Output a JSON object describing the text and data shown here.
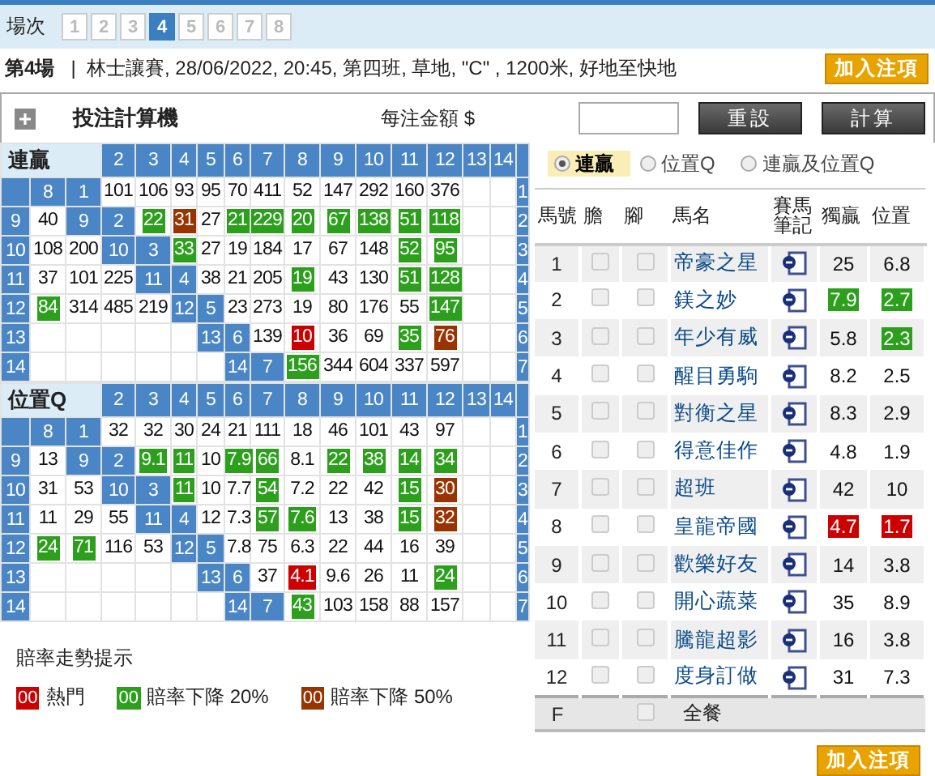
{
  "race_selector": {
    "label": "場次",
    "races": [
      {
        "label": "1",
        "selected": false
      },
      {
        "label": "2",
        "selected": false
      },
      {
        "label": "3",
        "selected": false
      },
      {
        "label": "4",
        "selected": true
      },
      {
        "label": "5",
        "selected": false
      },
      {
        "label": "6",
        "selected": false
      },
      {
        "label": "7",
        "selected": false
      },
      {
        "label": "8",
        "selected": false
      }
    ]
  },
  "race_info": {
    "race": "第4場",
    "separator": "|",
    "details": "林士讓賽, 28/06/2022, 20:45, 第四班, 草地, \"C\" , 1200米, 好地至快地",
    "add_button": "加入注項"
  },
  "calculator": {
    "title": "投注計算機",
    "amount_label": "每注金額 $",
    "reset_button": "重設",
    "calculate_button": "計算"
  },
  "grids": [
    {
      "title": "連贏",
      "headers": [
        "2",
        "3",
        "4",
        "5",
        "6",
        "7",
        "8",
        "9",
        "10",
        "11",
        "12",
        "13",
        "14"
      ],
      "rows": [
        [
          {
            "kind": "head"
          },
          {
            "kind": "head",
            "text": "8"
          },
          {
            "kind": "head",
            "text": "1"
          },
          {
            "kind": "odds",
            "text": "101"
          },
          {
            "kind": "odds",
            "text": "106"
          },
          {
            "kind": "odds",
            "text": "93"
          },
          {
            "kind": "odds",
            "text": "95"
          },
          {
            "kind": "odds",
            "text": "70"
          },
          {
            "kind": "odds",
            "text": "411"
          },
          {
            "kind": "odds",
            "text": "52"
          },
          {
            "kind": "odds",
            "text": "147"
          },
          {
            "kind": "odds",
            "text": "292"
          },
          {
            "kind": "odds",
            "text": "160"
          },
          {
            "kind": "odds",
            "text": "376"
          },
          {
            "kind": "blank"
          },
          {
            "kind": "blank"
          },
          {
            "kind": "head",
            "text": "1"
          }
        ],
        [
          {
            "kind": "head",
            "text": "9"
          },
          {
            "kind": "odds",
            "text": "40"
          },
          {
            "kind": "head",
            "text": "9"
          },
          {
            "kind": "head",
            "text": "2"
          },
          {
            "kind": "odds",
            "text": "22",
            "color": "#2ca01c"
          },
          {
            "kind": "odds",
            "text": "31",
            "color": "#993300"
          },
          {
            "kind": "odds",
            "text": "27"
          },
          {
            "kind": "odds",
            "text": "21",
            "color": "#2ca01c"
          },
          {
            "kind": "odds",
            "text": "229",
            "color": "#2ca01c"
          },
          {
            "kind": "odds",
            "text": "20",
            "color": "#2ca01c"
          },
          {
            "kind": "odds",
            "text": "67",
            "color": "#2ca01c"
          },
          {
            "kind": "odds",
            "text": "138",
            "color": "#2ca01c"
          },
          {
            "kind": "odds",
            "text": "51",
            "color": "#2ca01c"
          },
          {
            "kind": "odds",
            "text": "118",
            "color": "#2ca01c"
          },
          {
            "kind": "blank"
          },
          {
            "kind": "blank"
          },
          {
            "kind": "head",
            "text": "2"
          }
        ],
        [
          {
            "kind": "head",
            "text": "10"
          },
          {
            "kind": "odds",
            "text": "108"
          },
          {
            "kind": "odds",
            "text": "200"
          },
          {
            "kind": "head",
            "text": "10"
          },
          {
            "kind": "head",
            "text": "3"
          },
          {
            "kind": "odds",
            "text": "33",
            "color": "#2ca01c"
          },
          {
            "kind": "odds",
            "text": "27"
          },
          {
            "kind": "odds",
            "text": "19"
          },
          {
            "kind": "odds",
            "text": "184"
          },
          {
            "kind": "odds",
            "text": "17"
          },
          {
            "kind": "odds",
            "text": "67"
          },
          {
            "kind": "odds",
            "text": "148"
          },
          {
            "kind": "odds",
            "text": "52",
            "color": "#2ca01c"
          },
          {
            "kind": "odds",
            "text": "95",
            "color": "#2ca01c"
          },
          {
            "kind": "blank"
          },
          {
            "kind": "blank"
          },
          {
            "kind": "head",
            "text": "3"
          }
        ],
        [
          {
            "kind": "head",
            "text": "11"
          },
          {
            "kind": "odds",
            "text": "37"
          },
          {
            "kind": "odds",
            "text": "101"
          },
          {
            "kind": "odds",
            "text": "225"
          },
          {
            "kind": "head",
            "text": "11"
          },
          {
            "kind": "head",
            "text": "4"
          },
          {
            "kind": "odds",
            "text": "38"
          },
          {
            "kind": "odds",
            "text": "21"
          },
          {
            "kind": "odds",
            "text": "205"
          },
          {
            "kind": "odds",
            "text": "19",
            "color": "#2ca01c"
          },
          {
            "kind": "odds",
            "text": "43"
          },
          {
            "kind": "odds",
            "text": "130"
          },
          {
            "kind": "odds",
            "text": "51",
            "color": "#2ca01c"
          },
          {
            "kind": "odds",
            "text": "128",
            "color": "#2ca01c"
          },
          {
            "kind": "blank"
          },
          {
            "kind": "blank"
          },
          {
            "kind": "head",
            "text": "4"
          }
        ],
        [
          {
            "kind": "head",
            "text": "12"
          },
          {
            "kind": "odds",
            "text": "84",
            "color": "#2ca01c"
          },
          {
            "kind": "odds",
            "text": "314"
          },
          {
            "kind": "odds",
            "text": "485"
          },
          {
            "kind": "odds",
            "text": "219"
          },
          {
            "kind": "head",
            "text": "12"
          },
          {
            "kind": "head",
            "text": "5"
          },
          {
            "kind": "odds",
            "text": "23"
          },
          {
            "kind": "odds",
            "text": "273"
          },
          {
            "kind": "odds",
            "text": "19"
          },
          {
            "kind": "odds",
            "text": "80"
          },
          {
            "kind": "odds",
            "text": "176"
          },
          {
            "kind": "odds",
            "text": "55"
          },
          {
            "kind": "odds",
            "text": "147",
            "color": "#2ca01c"
          },
          {
            "kind": "blank"
          },
          {
            "kind": "blank"
          },
          {
            "kind": "head",
            "text": "5"
          }
        ],
        [
          {
            "kind": "head",
            "text": "13"
          },
          {
            "kind": "blank"
          },
          {
            "kind": "blank"
          },
          {
            "kind": "blank"
          },
          {
            "kind": "blank"
          },
          {
            "kind": "blank"
          },
          {
            "kind": "head",
            "text": "13"
          },
          {
            "kind": "head",
            "text": "6"
          },
          {
            "kind": "odds",
            "text": "139"
          },
          {
            "kind": "odds",
            "text": "10",
            "color": "#cc0000"
          },
          {
            "kind": "odds",
            "text": "36"
          },
          {
            "kind": "odds",
            "text": "69"
          },
          {
            "kind": "odds",
            "text": "35",
            "color": "#2ca01c"
          },
          {
            "kind": "odds",
            "text": "76",
            "color": "#993300"
          },
          {
            "kind": "blank"
          },
          {
            "kind": "blank"
          },
          {
            "kind": "head",
            "text": "6"
          }
        ],
        [
          {
            "kind": "head",
            "text": "14"
          },
          {
            "kind": "blank"
          },
          {
            "kind": "blank"
          },
          {
            "kind": "blank"
          },
          {
            "kind": "blank"
          },
          {
            "kind": "blank"
          },
          {
            "kind": "blank"
          },
          {
            "kind": "head",
            "text": "14"
          },
          {
            "kind": "head",
            "text": "7"
          },
          {
            "kind": "odds",
            "text": "156",
            "color": "#2ca01c"
          },
          {
            "kind": "odds",
            "text": "344"
          },
          {
            "kind": "odds",
            "text": "604"
          },
          {
            "kind": "odds",
            "text": "337"
          },
          {
            "kind": "odds",
            "text": "597"
          },
          {
            "kind": "blank"
          },
          {
            "kind": "blank"
          },
          {
            "kind": "head",
            "text": "7"
          }
        ]
      ]
    },
    {
      "title": "位置Q",
      "headers": [
        "2",
        "3",
        "4",
        "5",
        "6",
        "7",
        "8",
        "9",
        "10",
        "11",
        "12",
        "13",
        "14"
      ],
      "rows": [
        [
          {
            "kind": "head"
          },
          {
            "kind": "head",
            "text": "8"
          },
          {
            "kind": "head",
            "text": "1"
          },
          {
            "kind": "odds",
            "text": "32"
          },
          {
            "kind": "odds",
            "text": "32"
          },
          {
            "kind": "odds",
            "text": "30"
          },
          {
            "kind": "odds",
            "text": "24"
          },
          {
            "kind": "odds",
            "text": "21"
          },
          {
            "kind": "odds",
            "text": "111"
          },
          {
            "kind": "odds",
            "text": "18"
          },
          {
            "kind": "odds",
            "text": "46"
          },
          {
            "kind": "odds",
            "text": "101"
          },
          {
            "kind": "odds",
            "text": "43"
          },
          {
            "kind": "odds",
            "text": "97"
          },
          {
            "kind": "blank"
          },
          {
            "kind": "blank"
          },
          {
            "kind": "head",
            "text": "1"
          }
        ],
        [
          {
            "kind": "head",
            "text": "9"
          },
          {
            "kind": "odds",
            "text": "13"
          },
          {
            "kind": "head",
            "text": "9"
          },
          {
            "kind": "head",
            "text": "2"
          },
          {
            "kind": "odds",
            "text": "9.1",
            "color": "#2ca01c"
          },
          {
            "kind": "odds",
            "text": "11",
            "color": "#2ca01c"
          },
          {
            "kind": "odds",
            "text": "10"
          },
          {
            "kind": "odds",
            "text": "7.9",
            "color": "#2ca01c"
          },
          {
            "kind": "odds",
            "text": "66",
            "color": "#2ca01c"
          },
          {
            "kind": "odds",
            "text": "8.1"
          },
          {
            "kind": "odds",
            "text": "22",
            "color": "#2ca01c"
          },
          {
            "kind": "odds",
            "text": "38",
            "color": "#2ca01c"
          },
          {
            "kind": "odds",
            "text": "14",
            "color": "#2ca01c"
          },
          {
            "kind": "odds",
            "text": "34",
            "color": "#2ca01c"
          },
          {
            "kind": "blank"
          },
          {
            "kind": "blank"
          },
          {
            "kind": "head",
            "text": "2"
          }
        ],
        [
          {
            "kind": "head",
            "text": "10"
          },
          {
            "kind": "odds",
            "text": "31"
          },
          {
            "kind": "odds",
            "text": "53"
          },
          {
            "kind": "head",
            "text": "10"
          },
          {
            "kind": "head",
            "text": "3"
          },
          {
            "kind": "odds",
            "text": "11",
            "color": "#2ca01c"
          },
          {
            "kind": "odds",
            "text": "10"
          },
          {
            "kind": "odds",
            "text": "7.7"
          },
          {
            "kind": "odds",
            "text": "54",
            "color": "#2ca01c"
          },
          {
            "kind": "odds",
            "text": "7.2"
          },
          {
            "kind": "odds",
            "text": "22"
          },
          {
            "kind": "odds",
            "text": "42"
          },
          {
            "kind": "odds",
            "text": "15",
            "color": "#2ca01c"
          },
          {
            "kind": "odds",
            "text": "30",
            "color": "#993300"
          },
          {
            "kind": "blank"
          },
          {
            "kind": "blank"
          },
          {
            "kind": "head",
            "text": "3"
          }
        ],
        [
          {
            "kind": "head",
            "text": "11"
          },
          {
            "kind": "odds",
            "text": "11"
          },
          {
            "kind": "odds",
            "text": "29"
          },
          {
            "kind": "odds",
            "text": "55"
          },
          {
            "kind": "head",
            "text": "11"
          },
          {
            "kind": "head",
            "text": "4"
          },
          {
            "kind": "odds",
            "text": "12"
          },
          {
            "kind": "odds",
            "text": "7.3"
          },
          {
            "kind": "odds",
            "text": "57",
            "color": "#2ca01c"
          },
          {
            "kind": "odds",
            "text": "7.6",
            "color": "#2ca01c"
          },
          {
            "kind": "odds",
            "text": "13"
          },
          {
            "kind": "odds",
            "text": "38"
          },
          {
            "kind": "odds",
            "text": "15",
            "color": "#2ca01c"
          },
          {
            "kind": "odds",
            "text": "32",
            "color": "#993300"
          },
          {
            "kind": "blank"
          },
          {
            "kind": "blank"
          },
          {
            "kind": "head",
            "text": "4"
          }
        ],
        [
          {
            "kind": "head",
            "text": "12"
          },
          {
            "kind": "odds",
            "text": "24",
            "color": "#2ca01c"
          },
          {
            "kind": "odds",
            "text": "71",
            "color": "#2ca01c"
          },
          {
            "kind": "odds",
            "text": "116"
          },
          {
            "kind": "odds",
            "text": "53"
          },
          {
            "kind": "head",
            "text": "12"
          },
          {
            "kind": "head",
            "text": "5"
          },
          {
            "kind": "odds",
            "text": "7.8"
          },
          {
            "kind": "odds",
            "text": "75"
          },
          {
            "kind": "odds",
            "text": "6.3"
          },
          {
            "kind": "odds",
            "text": "22"
          },
          {
            "kind": "odds",
            "text": "44"
          },
          {
            "kind": "odds",
            "text": "16"
          },
          {
            "kind": "odds",
            "text": "39"
          },
          {
            "kind": "blank"
          },
          {
            "kind": "blank"
          },
          {
            "kind": "head",
            "text": "5"
          }
        ],
        [
          {
            "kind": "head",
            "text": "13"
          },
          {
            "kind": "blank"
          },
          {
            "kind": "blank"
          },
          {
            "kind": "blank"
          },
          {
            "kind": "blank"
          },
          {
            "kind": "blank"
          },
          {
            "kind": "head",
            "text": "13"
          },
          {
            "kind": "head",
            "text": "6"
          },
          {
            "kind": "odds",
            "text": "37"
          },
          {
            "kind": "odds",
            "text": "4.1",
            "color": "#cc0000"
          },
          {
            "kind": "odds",
            "text": "9.6"
          },
          {
            "kind": "odds",
            "text": "26"
          },
          {
            "kind": "odds",
            "text": "11"
          },
          {
            "kind": "odds",
            "text": "24",
            "color": "#2ca01c"
          },
          {
            "kind": "blank"
          },
          {
            "kind": "blank"
          },
          {
            "kind": "head",
            "text": "6"
          }
        ],
        [
          {
            "kind": "head",
            "text": "14"
          },
          {
            "kind": "blank"
          },
          {
            "kind": "blank"
          },
          {
            "kind": "blank"
          },
          {
            "kind": "blank"
          },
          {
            "kind": "blank"
          },
          {
            "kind": "blank"
          },
          {
            "kind": "head",
            "text": "14"
          },
          {
            "kind": "head",
            "text": "7"
          },
          {
            "kind": "odds",
            "text": "43",
            "color": "#2ca01c"
          },
          {
            "kind": "odds",
            "text": "103"
          },
          {
            "kind": "odds",
            "text": "158"
          },
          {
            "kind": "odds",
            "text": "88"
          },
          {
            "kind": "odds",
            "text": "157"
          },
          {
            "kind": "blank"
          },
          {
            "kind": "blank"
          },
          {
            "kind": "head",
            "text": "7"
          }
        ]
      ]
    }
  ],
  "legend": {
    "title": "賠率走勢提示",
    "items": [
      {
        "color": "#cc0000",
        "sample": "00",
        "label": "熱門"
      },
      {
        "color": "#2ca01c",
        "sample": "00",
        "label": "賠率下降 20%"
      },
      {
        "color": "#993300",
        "sample": "00",
        "label": "賠率下降 50%"
      }
    ]
  },
  "pool_options": [
    {
      "label": "連贏",
      "selected": true
    },
    {
      "label": "位置Q",
      "selected": false
    },
    {
      "label": "連贏及位置Q",
      "selected": false
    }
  ],
  "horse_table": {
    "columns": [
      "馬號",
      "膽",
      "腳",
      "馬名",
      "賽馬筆記",
      "獨贏",
      "位置"
    ],
    "rows": [
      {
        "number": "1",
        "banker": false,
        "leg": false,
        "name": "帝豪之星",
        "win": {
          "text": "25"
        },
        "place": {
          "text": "6.8"
        }
      },
      {
        "number": "2",
        "banker": false,
        "leg": false,
        "name": "鎂之妙",
        "win": {
          "text": "7.9",
          "color": "#2ca01c"
        },
        "place": {
          "text": "2.7",
          "color": "#2ca01c"
        }
      },
      {
        "number": "3",
        "banker": false,
        "leg": false,
        "name": "年少有威",
        "win": {
          "text": "5.8"
        },
        "place": {
          "text": "2.3",
          "color": "#2ca01c"
        }
      },
      {
        "number": "4",
        "banker": false,
        "leg": false,
        "name": "醒目勇駒",
        "win": {
          "text": "8.2"
        },
        "place": {
          "text": "2.5"
        }
      },
      {
        "number": "5",
        "banker": false,
        "leg": false,
        "name": "對衡之星",
        "win": {
          "text": "8.3"
        },
        "place": {
          "text": "2.9"
        }
      },
      {
        "number": "6",
        "banker": false,
        "leg": false,
        "name": "得意佳作",
        "win": {
          "text": "4.8"
        },
        "place": {
          "text": "1.9"
        }
      },
      {
        "number": "7",
        "banker": false,
        "leg": false,
        "name": "超班",
        "win": {
          "text": "42"
        },
        "place": {
          "text": "10"
        }
      },
      {
        "number": "8",
        "banker": false,
        "leg": false,
        "name": "皇龍帝國",
        "win": {
          "text": "4.7",
          "color": "#cc0000"
        },
        "place": {
          "text": "1.7",
          "color": "#cc0000"
        }
      },
      {
        "number": "9",
        "banker": false,
        "leg": false,
        "name": "歡樂好友",
        "win": {
          "text": "14"
        },
        "place": {
          "text": "3.8"
        }
      },
      {
        "number": "10",
        "banker": false,
        "leg": false,
        "name": "開心蔬菜",
        "win": {
          "text": "35"
        },
        "place": {
          "text": "8.9"
        }
      },
      {
        "number": "11",
        "banker": false,
        "leg": false,
        "name": "騰龍超影",
        "win": {
          "text": "16"
        },
        "place": {
          "text": "3.8"
        }
      },
      {
        "number": "12",
        "banker": false,
        "leg": false,
        "name": "度身訂做",
        "win": {
          "text": "31"
        },
        "place": {
          "text": "7.3"
        }
      }
    ],
    "field_row": {
      "number": "F",
      "leg": false,
      "label": "全餐"
    }
  },
  "add_button": "加入注項"
}
